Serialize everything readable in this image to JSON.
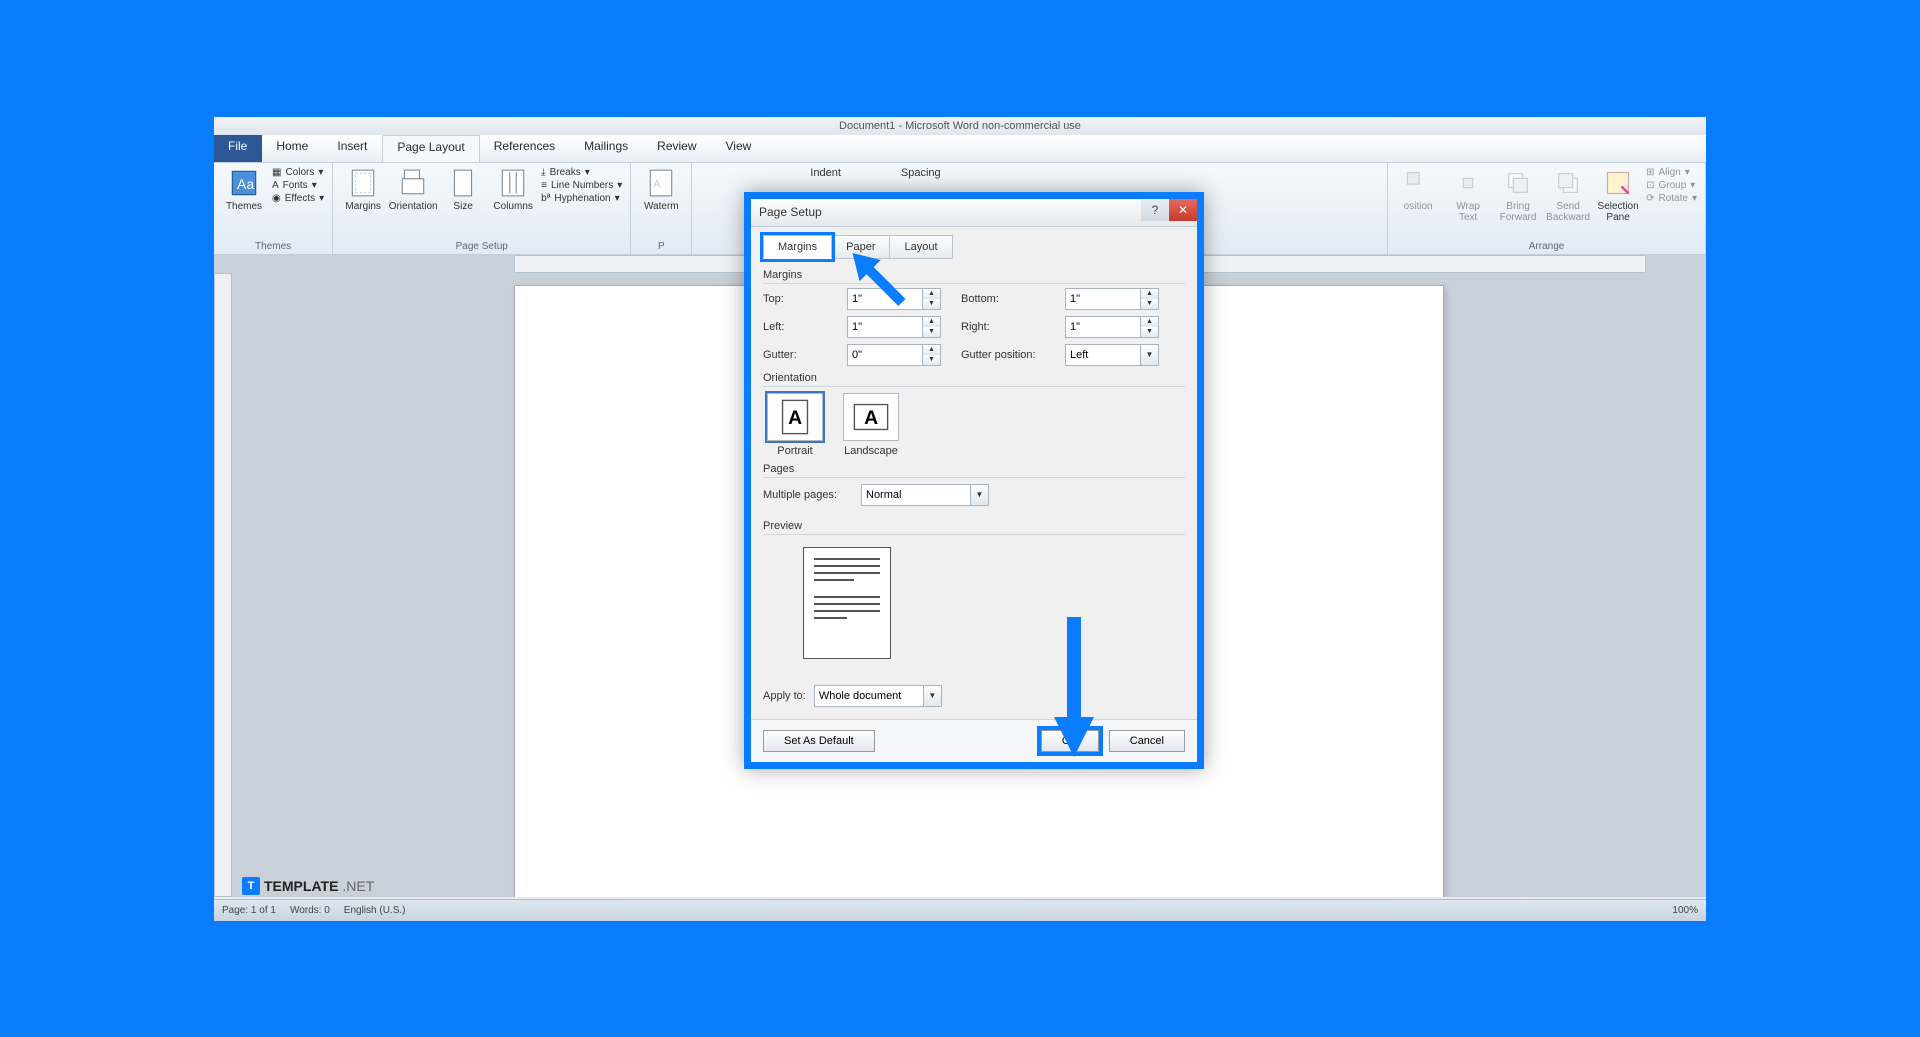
{
  "window": {
    "title": "Document1 - Microsoft Word non-commercial use"
  },
  "tabs": {
    "file": "File",
    "items": [
      "Home",
      "Insert",
      "Page Layout",
      "References",
      "Mailings",
      "Review",
      "View"
    ],
    "active_index": 2
  },
  "ribbon": {
    "themes": {
      "title": "Themes",
      "colors": "Colors",
      "fonts": "Fonts",
      "effects": "Effects"
    },
    "page_setup": {
      "title": "Page Setup",
      "margins": "Margins",
      "orientation": "Orientation",
      "size": "Size",
      "columns": "Columns",
      "breaks": "Breaks",
      "line_numbers": "Line Numbers",
      "hyphenation": "Hyphenation"
    },
    "background": {
      "watermark": "Waterm",
      "p": "P"
    },
    "paragraph": {
      "indent": "Indent",
      "spacing": "Spacing"
    },
    "arrange": {
      "title": "Arrange",
      "position": "osition",
      "wrap": "Wrap Text",
      "forward": "Bring Forward",
      "backward": "Send Backward",
      "selection": "Selection Pane",
      "align": "Align",
      "group": "Group",
      "rotate": "Rotate"
    }
  },
  "dialog": {
    "title": "Page Setup",
    "tabs": {
      "margins": "Margins",
      "paper": "Paper",
      "layout": "Layout"
    },
    "margins_section": "Margins",
    "fields": {
      "top_label": "Top:",
      "top_value": "1\"",
      "bottom_label": "Bottom:",
      "bottom_value": "1\"",
      "left_label": "Left:",
      "left_value": "1\"",
      "right_label": "Right:",
      "right_value": "1\"",
      "gutter_label": "Gutter:",
      "gutter_value": "0\"",
      "gutter_pos_label": "Gutter position:",
      "gutter_pos_value": "Left"
    },
    "orientation": {
      "label": "Orientation",
      "portrait": "Portrait",
      "landscape": "Landscape"
    },
    "pages": {
      "label": "Pages",
      "multiple_label": "Multiple pages:",
      "multiple_value": "Normal"
    },
    "preview": "Preview",
    "apply": {
      "label": "Apply to:",
      "value": "Whole document"
    },
    "buttons": {
      "default": "Set As Default",
      "ok": "OK",
      "cancel": "Cancel"
    }
  },
  "status": {
    "page": "Page: 1 of 1",
    "words": "Words: 0",
    "lang": "English (U.S.)",
    "zoom": "100%"
  },
  "watermark": {
    "brand": "TEMPLATE",
    "suffix": ".NET"
  }
}
